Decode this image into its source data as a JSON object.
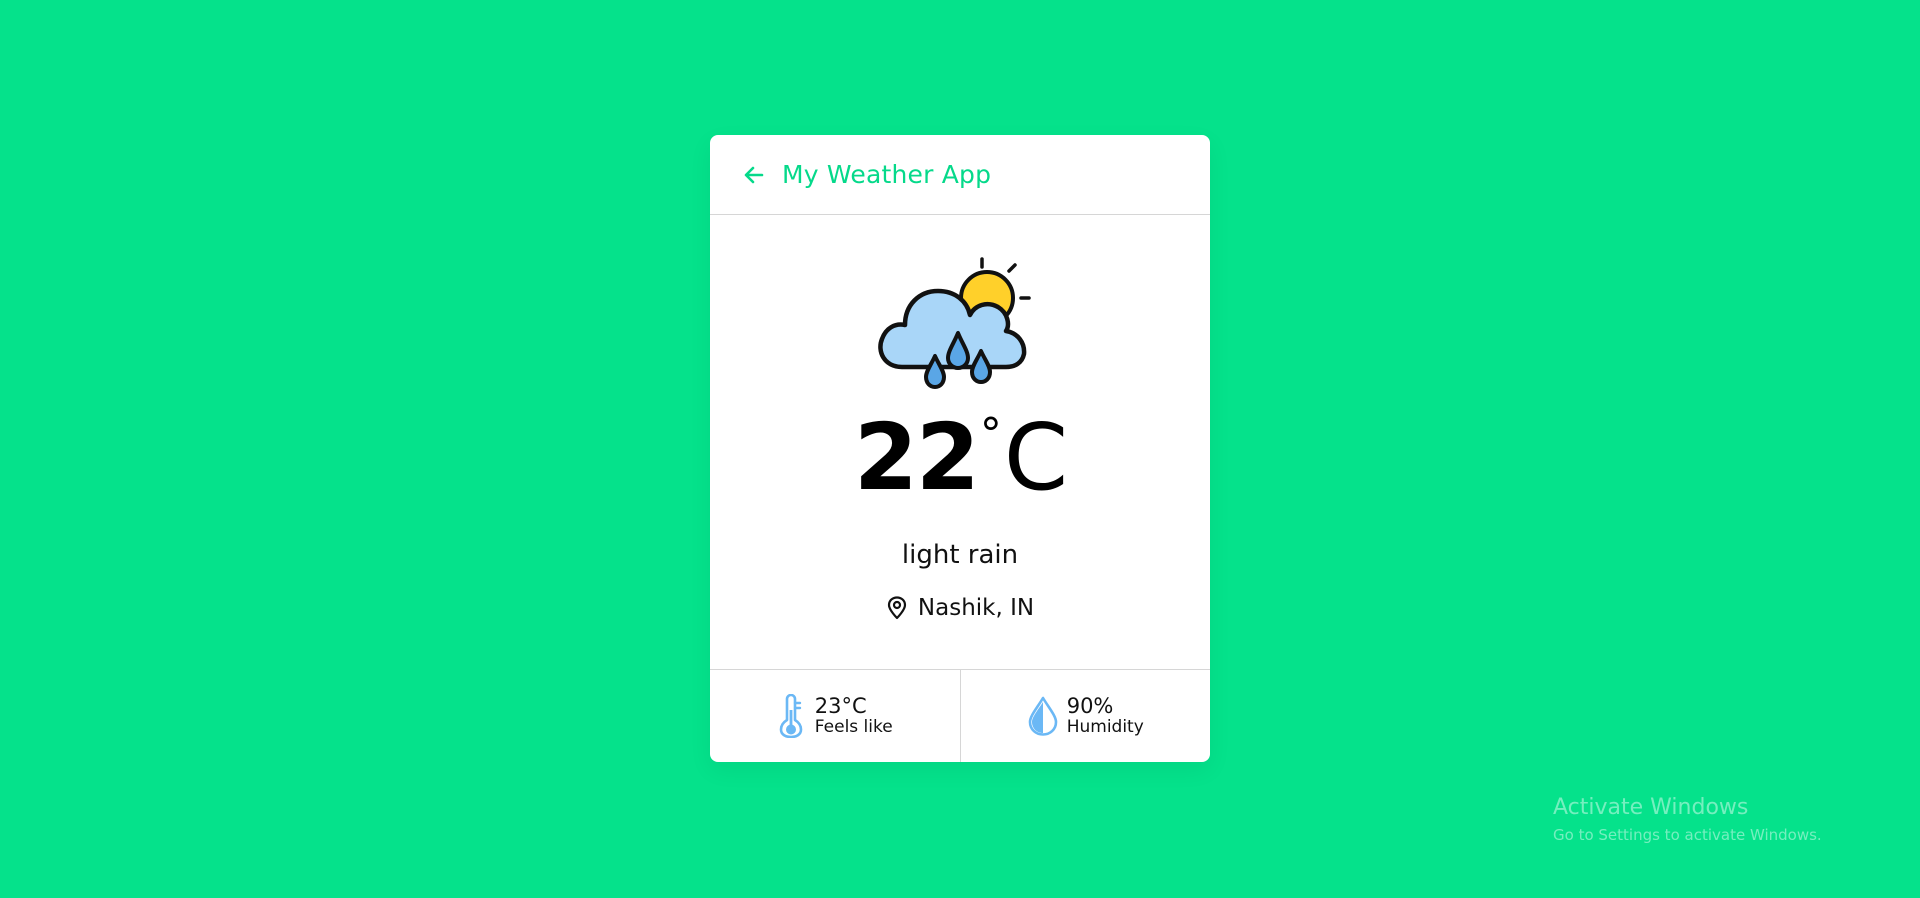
{
  "header": {
    "title": "My Weather App",
    "back_icon": "arrow-left-icon"
  },
  "weather": {
    "icon": "rain-cloud-sun-icon",
    "temperature": "22",
    "degree_symbol": "°",
    "unit": "C",
    "description": "light rain",
    "location": "Nashik, IN",
    "location_icon": "map-pin-icon"
  },
  "stats": {
    "feels_like": {
      "value": "23°C",
      "label": "Feels like",
      "icon": "thermometer-icon"
    },
    "humidity": {
      "value": "90%",
      "label": "Humidity",
      "icon": "droplet-icon"
    }
  },
  "watermark": {
    "title": "Activate Windows",
    "subtitle": "Go to Settings to activate Windows."
  },
  "colors": {
    "background": "#05e28b",
    "accent": "#05d98a",
    "icon_blue": "#6bb8f5",
    "sun": "#ffd02a",
    "cloud": "#a9d6f8"
  }
}
